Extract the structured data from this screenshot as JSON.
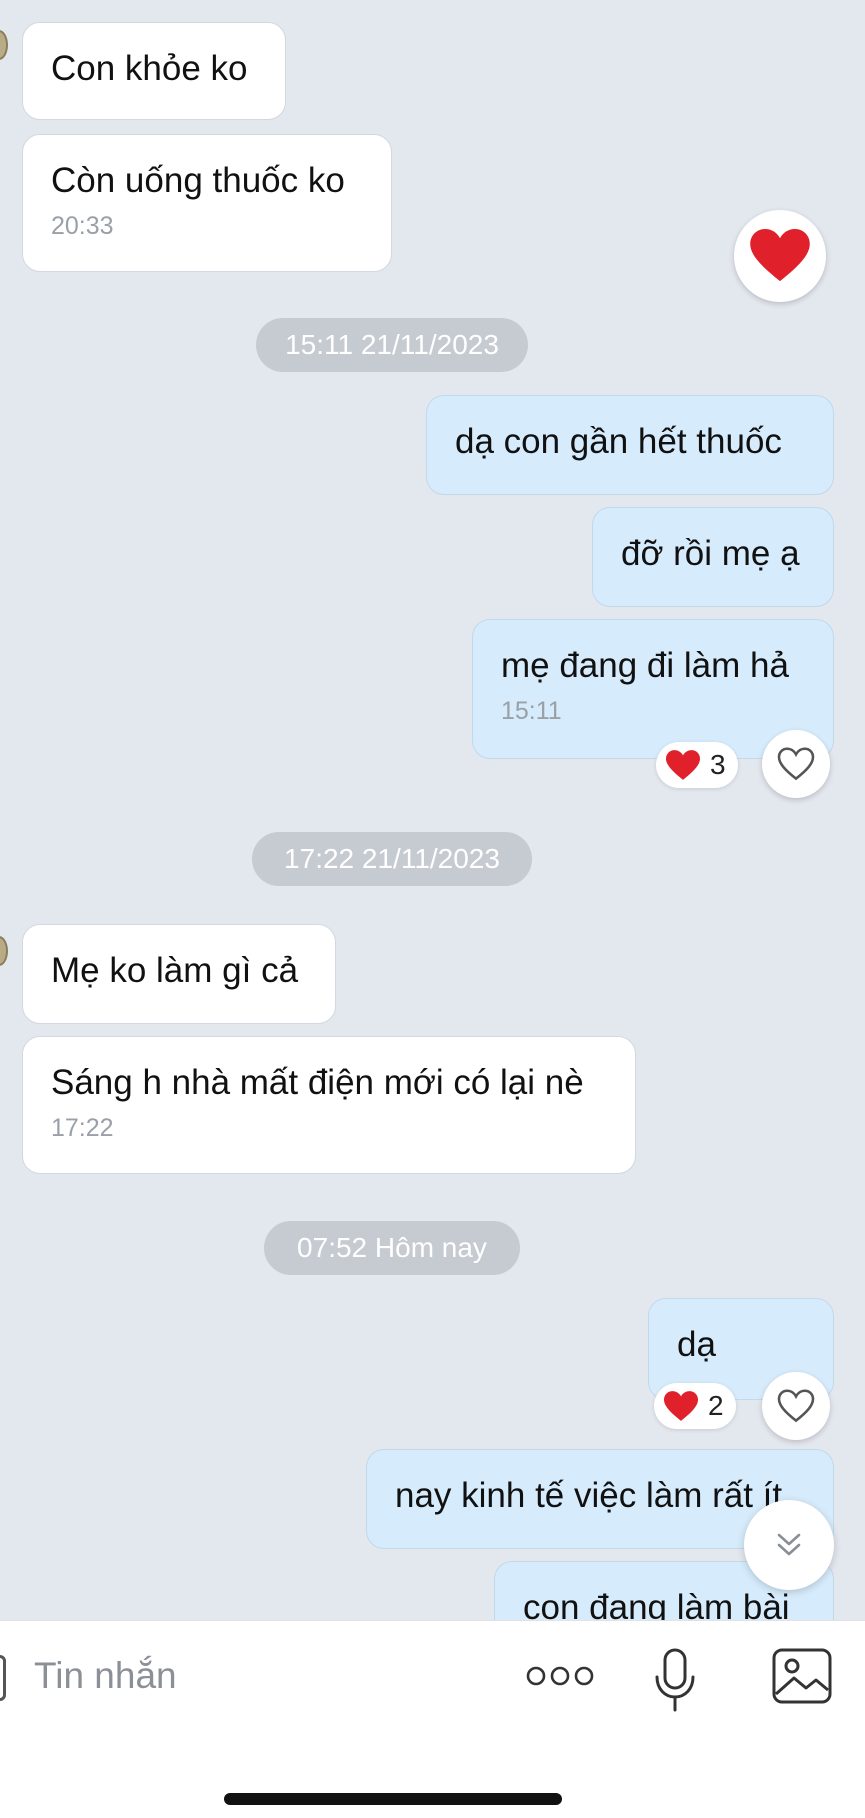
{
  "messages": {
    "m1": {
      "text": "Con khỏe ko"
    },
    "m2": {
      "text": "Còn uống thuốc ko",
      "time": "20:33"
    },
    "d1": "15:11 21/11/2023",
    "m3": {
      "text": "dạ con gần hết thuốc"
    },
    "m4": {
      "text": "đỡ rồi mẹ ạ"
    },
    "m5": {
      "text": "mẹ đang đi làm hả",
      "time": "15:11",
      "reaction_count": "3"
    },
    "d2": "17:22 21/11/2023",
    "m6": {
      "text": "Mẹ ko làm gì cả"
    },
    "m7": {
      "text": "Sáng h nhà mất điện mới có lại nè",
      "time": "17:22"
    },
    "d3": "07:52 Hôm nay",
    "m8": {
      "text": "dạ",
      "reaction_count": "2"
    },
    "m9": {
      "text": "nay kinh tế việc làm rất ít"
    },
    "m10": {
      "text": "con đang làm bài"
    }
  },
  "input": {
    "placeholder": "Tin nhắn"
  },
  "icons": {
    "reaction": "heart-icon",
    "react_button": "heart-outline-icon",
    "scroll": "double-chevron-down-icon",
    "more": "more-dots-icon",
    "mic": "microphone-icon",
    "gallery": "image-icon"
  },
  "colors": {
    "background": "#e3e7ee",
    "incoming_bubble": "#ffffff",
    "outgoing_bubble": "#d6ebfb",
    "heart": "#e0202a",
    "date_chip": "#c6cad1"
  }
}
